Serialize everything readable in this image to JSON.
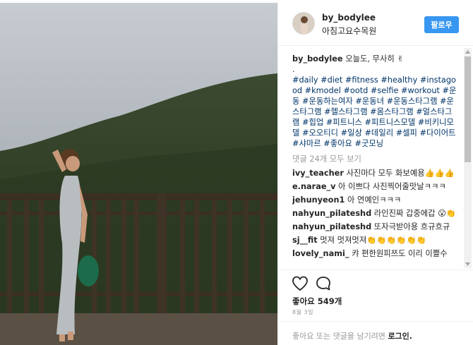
{
  "post": {
    "username": "by_bodylee",
    "location": "아침고요수목원",
    "follow_label": "팔로우"
  },
  "caption": {
    "username": "by_bodylee",
    "text": "오늘도, 무사히 ✌",
    "dot": ".",
    "hashtags": "#daily #diet #fitness #healthy #instagood #kmodel #ootd #selfie #workout #운동 #운동하는여자 #운동녀 #운동스타그램 #운스타그램 #헬스타그램 #몸스타그램 #얼스타그램 #힙업 #피트니스 #피트니스모델 #비키니모델 #오오티디 #일상 #데일리 #셀피 #다이어트 #샤마르 #좋아요 #굿모닝"
  },
  "view_all_comments": "댓글 24개 모두 보기",
  "comments": [
    {
      "username": "ivy_teacher",
      "text": "사진마다 모두 화보예용👍👍👍"
    },
    {
      "username": "e.narae_v",
      "text": "아 이쁘다 사진찍어줄맛날ㅋㅋㅋ"
    },
    {
      "username": "jehunyeon1",
      "text": "아 연예인ㅋㅋㅋ"
    },
    {
      "username": "nahyun_pilateshd",
      "text": "라인진짜 갑중에갑 😮👏👏"
    },
    {
      "username": "nahyun_pilateshd",
      "text": "또자극받아용 흐규흐규"
    },
    {
      "username": "sj__fit",
      "text": "멋져 멋져멋져👏👏👏👏👏👏"
    },
    {
      "username": "lovely_nami_",
      "text": "캬 편한원피쯔도 이리 이쁠수"
    }
  ],
  "likes": "좋아요 549개",
  "date": "8월 3일",
  "login_prompt": {
    "text": "좋아요 또는 댓글을 남기려면",
    "link": "로그인."
  },
  "icons": {
    "like": "heart-outline-icon",
    "comment": "comment-bubble-icon",
    "scroll_up": "triangle-up-icon",
    "scroll_down": "triangle-down-icon"
  },
  "colors": {
    "follow_button": "#3897f0",
    "hashtag": "#003569",
    "muted": "#999999"
  }
}
